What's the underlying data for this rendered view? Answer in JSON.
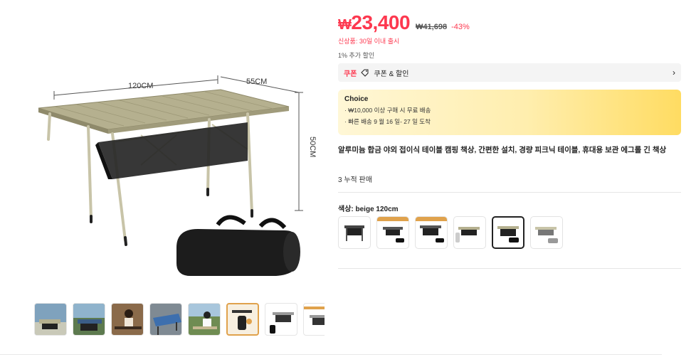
{
  "product": {
    "price_currency": "₩",
    "price_value": "23,400",
    "original_price": "₩41,698",
    "discount": "-43%",
    "new_user_notice": "신상품: 30일 이내 출시",
    "extra_discount": "1% 추가 할인",
    "coupon": {
      "tag": "쿠폰",
      "text": "쿠폰 & 할인",
      "icon": "tag-icon",
      "chevron": "›"
    },
    "choice": {
      "title": "Choice",
      "line1": "· ₩10,000 이상 구매 시 무료 배송",
      "line2": "· 빠른 배송 9 월 16 일- 27 일 도착"
    },
    "title": "알루미늄 합금 야외 접이식 테이블 캠핑 책상, 간편한 설치, 경량 피크닉 테이블, 휴대용 보관 에그롤 긴 책상",
    "sold": "3 누적 판매",
    "color_label": "색상: beige 120cm"
  },
  "main_image": {
    "dim_width": "120CM",
    "dim_depth": "55CM",
    "dim_height": "50CM"
  },
  "thumbnails": [
    {
      "name": "thumb-1",
      "bg": "#7fa2bd"
    },
    {
      "name": "thumb-2",
      "bg": "#5d7a4f"
    },
    {
      "name": "thumb-3",
      "bg": "#8a6a4a"
    },
    {
      "name": "thumb-4",
      "bg": "#7f8a93"
    },
    {
      "name": "thumb-5",
      "bg": "#6f8c52"
    },
    {
      "name": "thumb-6",
      "bg": "#f7efe0"
    },
    {
      "name": "thumb-7",
      "bg": "#ffffff"
    },
    {
      "name": "thumb-8",
      "bg": "#ffffff"
    }
  ],
  "colors": {
    "price_red": "#fd384f",
    "choice_gradient_end": "#ffdc62",
    "table_top": "#b5b08f",
    "table_bag": "#1c1c1c"
  }
}
